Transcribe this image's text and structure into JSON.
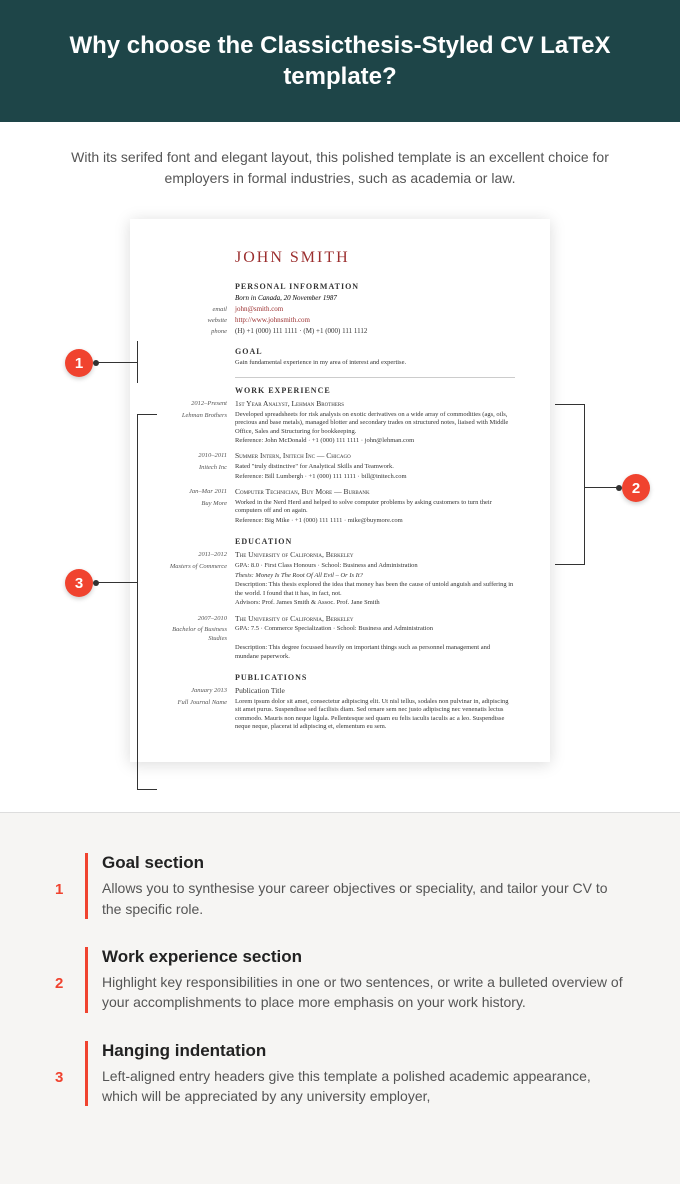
{
  "header": {
    "title": "Why choose the Classicthesis-Styled CV LaTeX template?"
  },
  "intro": "With its serifed font and elegant layout, this polished template is an excellent choice for employers in formal industries, such as academia or law.",
  "resume": {
    "name": "JOHN SMITH",
    "personal_info_title": "PERSONAL INFORMATION",
    "born": "Born in Canada, 20 November 1987",
    "email_label": "email",
    "email": "john@smith.com",
    "website_label": "website",
    "website": "http://www.johnsmith.com",
    "phone_label": "phone",
    "phone": "(H) +1 (000) 111 1111  ·  (M) +1 (000) 111 1112",
    "goal_title": "GOAL",
    "goal_text": "Gain fundamental experience in my area of interest and expertise.",
    "work_title": "WORK EXPERIENCE",
    "jobs": [
      {
        "side": "Lehman Brothers",
        "date": "2012–Present",
        "title": "1st Year Analyst, Lehman Brothers",
        "desc": "Developed spreadsheets for risk analysis on exotic derivatives on a wide array of commodities (ags, oils, precious and base metals), managed blotter and secondary trades on structured notes, liaised with Middle Office, Sales and Structuring for bookkeeping.",
        "ref": "Reference: John McDonald  · +1 (000) 111 1111  ·  john@lehman.com"
      },
      {
        "side": "Initech Inc",
        "date": "2010–2011",
        "title": "Summer Intern, Initech Inc — Chicago",
        "desc": "Rated \"truly distinctive\" for Analytical Skills and Teamwork.",
        "ref": "Reference: Bill Lumbergh · +1 (000) 111 1111  ·  bill@initech.com"
      },
      {
        "side": "Buy More",
        "date": "Jan–Mar 2011",
        "title": "Computer Technician, Buy More — Burbank",
        "desc": "Worked in the Nerd Herd and helped to solve computer problems by asking customers to turn their computers off and on again.",
        "ref": "Reference: Big Mike · +1 (000) 111 1111  ·  mike@buymore.com"
      }
    ],
    "edu_title": "EDUCATION",
    "edus": [
      {
        "side": "Masters of Commerce",
        "date": "2011–2012",
        "school": "The University of California, Berkeley",
        "line1": "GPA: 8.0  ·  First Class Honours  ·  School: Business and Administration",
        "line2": "Thesis: Money Is The Root Of All Evil – Or Is It?",
        "line3": "Description: This thesis explored the idea that money has been the cause of untold anguish and suffering in the world. I found that it has, in fact, not.",
        "line4": "Advisors: Prof. James Smith & Assoc. Prof. Jane Smith"
      },
      {
        "side": "Bachelor of Business Studies",
        "date": "2007–2010",
        "school": "The University of California, Berkeley",
        "line1": "GPA: 7.5  ·  Commerce Specialization  ·  School: Business and Administration",
        "line2": "Description: This degree focussed heavily on important things such as personnel management and mundane paperwork."
      }
    ],
    "pub_title": "PUBLICATIONS",
    "pub": {
      "side": "Full Journal Name",
      "date": "January 2013",
      "title": "Publication Title",
      "desc": "Lorem ipsum dolor sit amet, consectetur adipiscing elit. Ut nisl tellus, sodales non pulvinar in, adipiscing sit amet purus. Suspendisse sed facilisis diam. Sed ornare sem nec justo adipiscing nec venenatis lectus commodo. Mauris non neque ligula. Pellentesque sed quam eu felis iaculis iaculis ac a leo. Suspendisse neque neque, placerat id adipiscing et, elementum eu sem."
    }
  },
  "badges": {
    "b1": "1",
    "b2": "2",
    "b3": "3"
  },
  "features": [
    {
      "num": "1",
      "title": "Goal section",
      "desc": "Allows you to synthesise your career objectives or speciality, and tailor your CV to the specific role."
    },
    {
      "num": "2",
      "title": "Work experience section",
      "desc": "Highlight key responsibilities in one or two sentences, or write a bulleted overview of your accomplishments to place more emphasis on your work history."
    },
    {
      "num": "3",
      "title": "Hanging indentation",
      "desc": "Left-aligned entry headers give this template a polished academic appearance, which will be appreciated by any university employer,"
    }
  ]
}
